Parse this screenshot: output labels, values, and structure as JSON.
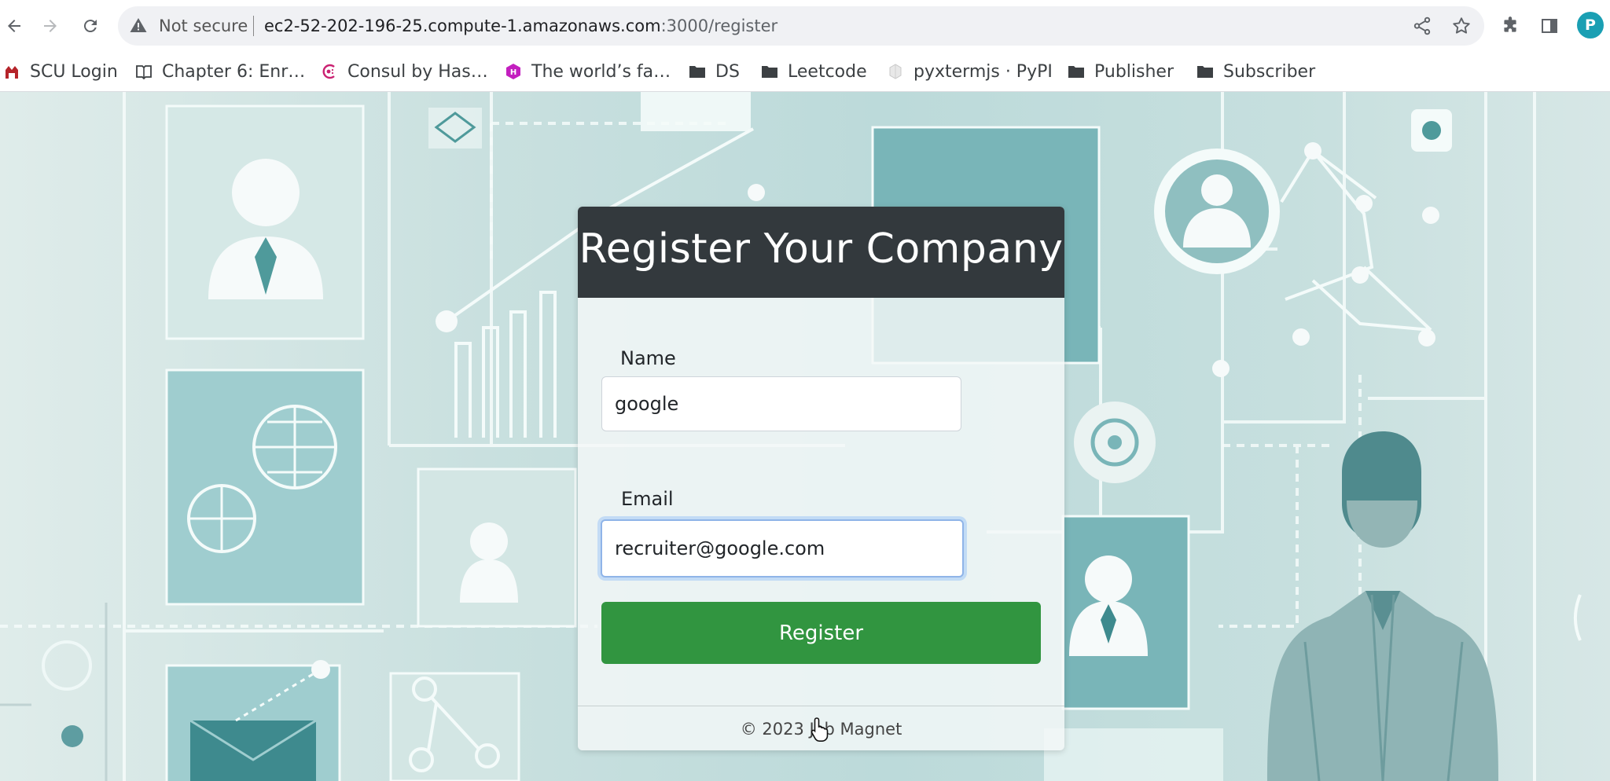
{
  "browser": {
    "security_label": "Not secure",
    "url_host": "ec2-52-202-196-25.compute-1.amazonaws.com",
    "url_path": ":3000/register",
    "profile_initial": "P",
    "profile_color": "#1a9fb3",
    "icons": [
      "back-icon",
      "forward-icon",
      "reload-icon",
      "warning-icon",
      "share-icon",
      "star-icon",
      "extensions-icon",
      "side-panel-icon"
    ]
  },
  "bookmarks": [
    {
      "label": "SCU Login",
      "icon": "scu-icon"
    },
    {
      "label": "Chapter 6: Enr…",
      "icon": "book-icon"
    },
    {
      "label": "Consul by Has…",
      "icon": "consul-icon"
    },
    {
      "label": "The world’s fa…",
      "icon": "hexagon-icon"
    },
    {
      "label": "DS",
      "icon": "folder-icon"
    },
    {
      "label": "Leetcode",
      "icon": "folder-icon"
    },
    {
      "label": "pyxtermjs · PyPI",
      "icon": "pypi-icon"
    },
    {
      "label": "Publisher",
      "icon": "folder-icon"
    },
    {
      "label": "Subscriber",
      "icon": "folder-icon"
    }
  ],
  "form": {
    "title": "Register Your Company",
    "name_label": "Name",
    "name_value": "google",
    "email_label": "Email",
    "email_value": "recruiter@google.com",
    "submit_label": "Register",
    "footer": "© 2023 Job Magnet",
    "button_color": "#319540",
    "header_color": "#33393d"
  }
}
